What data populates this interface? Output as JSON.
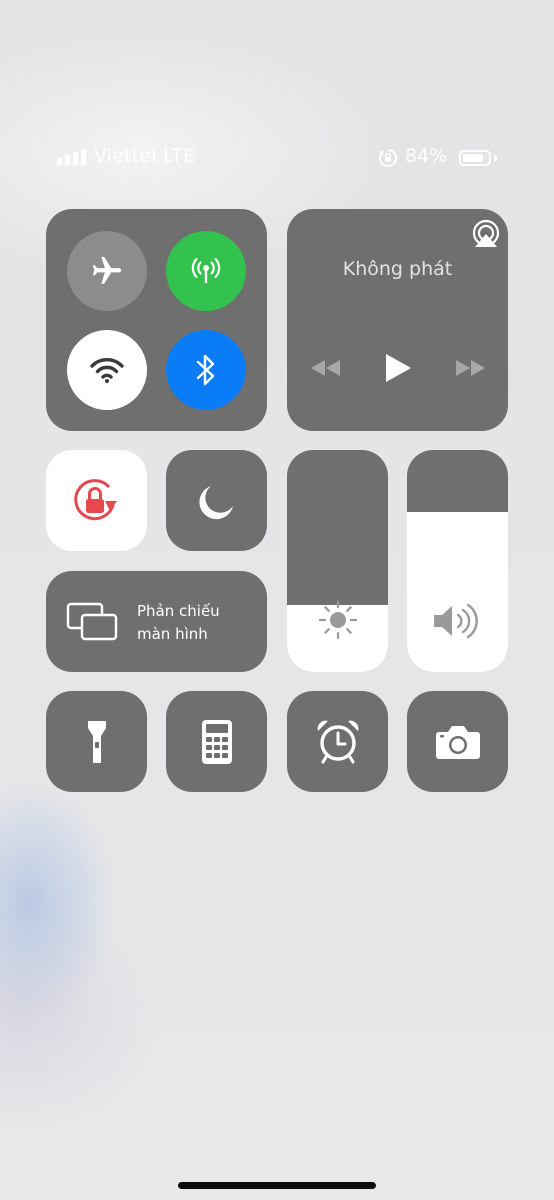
{
  "status_bar": {
    "carrier": "Viettel LTE",
    "battery_percent_label": "84%",
    "battery_level": 0.84,
    "signal_bars": 4
  },
  "connectivity": {
    "airplane_mode": "off",
    "cellular_data": "on",
    "wifi": "on",
    "bluetooth": "on"
  },
  "now_playing": {
    "title": "Không phát",
    "airplay_icon": "airplay-icon",
    "controls": [
      "rewind-icon",
      "play-icon",
      "fast-forward-icon"
    ]
  },
  "toggles": {
    "orientation_lock": "on",
    "do_not_disturb": "off"
  },
  "screen_mirroring": {
    "label_line1": "Phản chiếu",
    "label_line2": "màn hình"
  },
  "sliders": {
    "brightness_level": 0.3,
    "volume_level": 0.72
  },
  "bottom_row": [
    "flashlight-icon",
    "calculator-icon",
    "alarm-clock-icon",
    "camera-icon"
  ],
  "colors": {
    "tile": "#6f6f6f",
    "cellular_active": "#32c24d",
    "bluetooth_active": "#0b7cf7",
    "orientation_lock_red": "#e5484d"
  }
}
